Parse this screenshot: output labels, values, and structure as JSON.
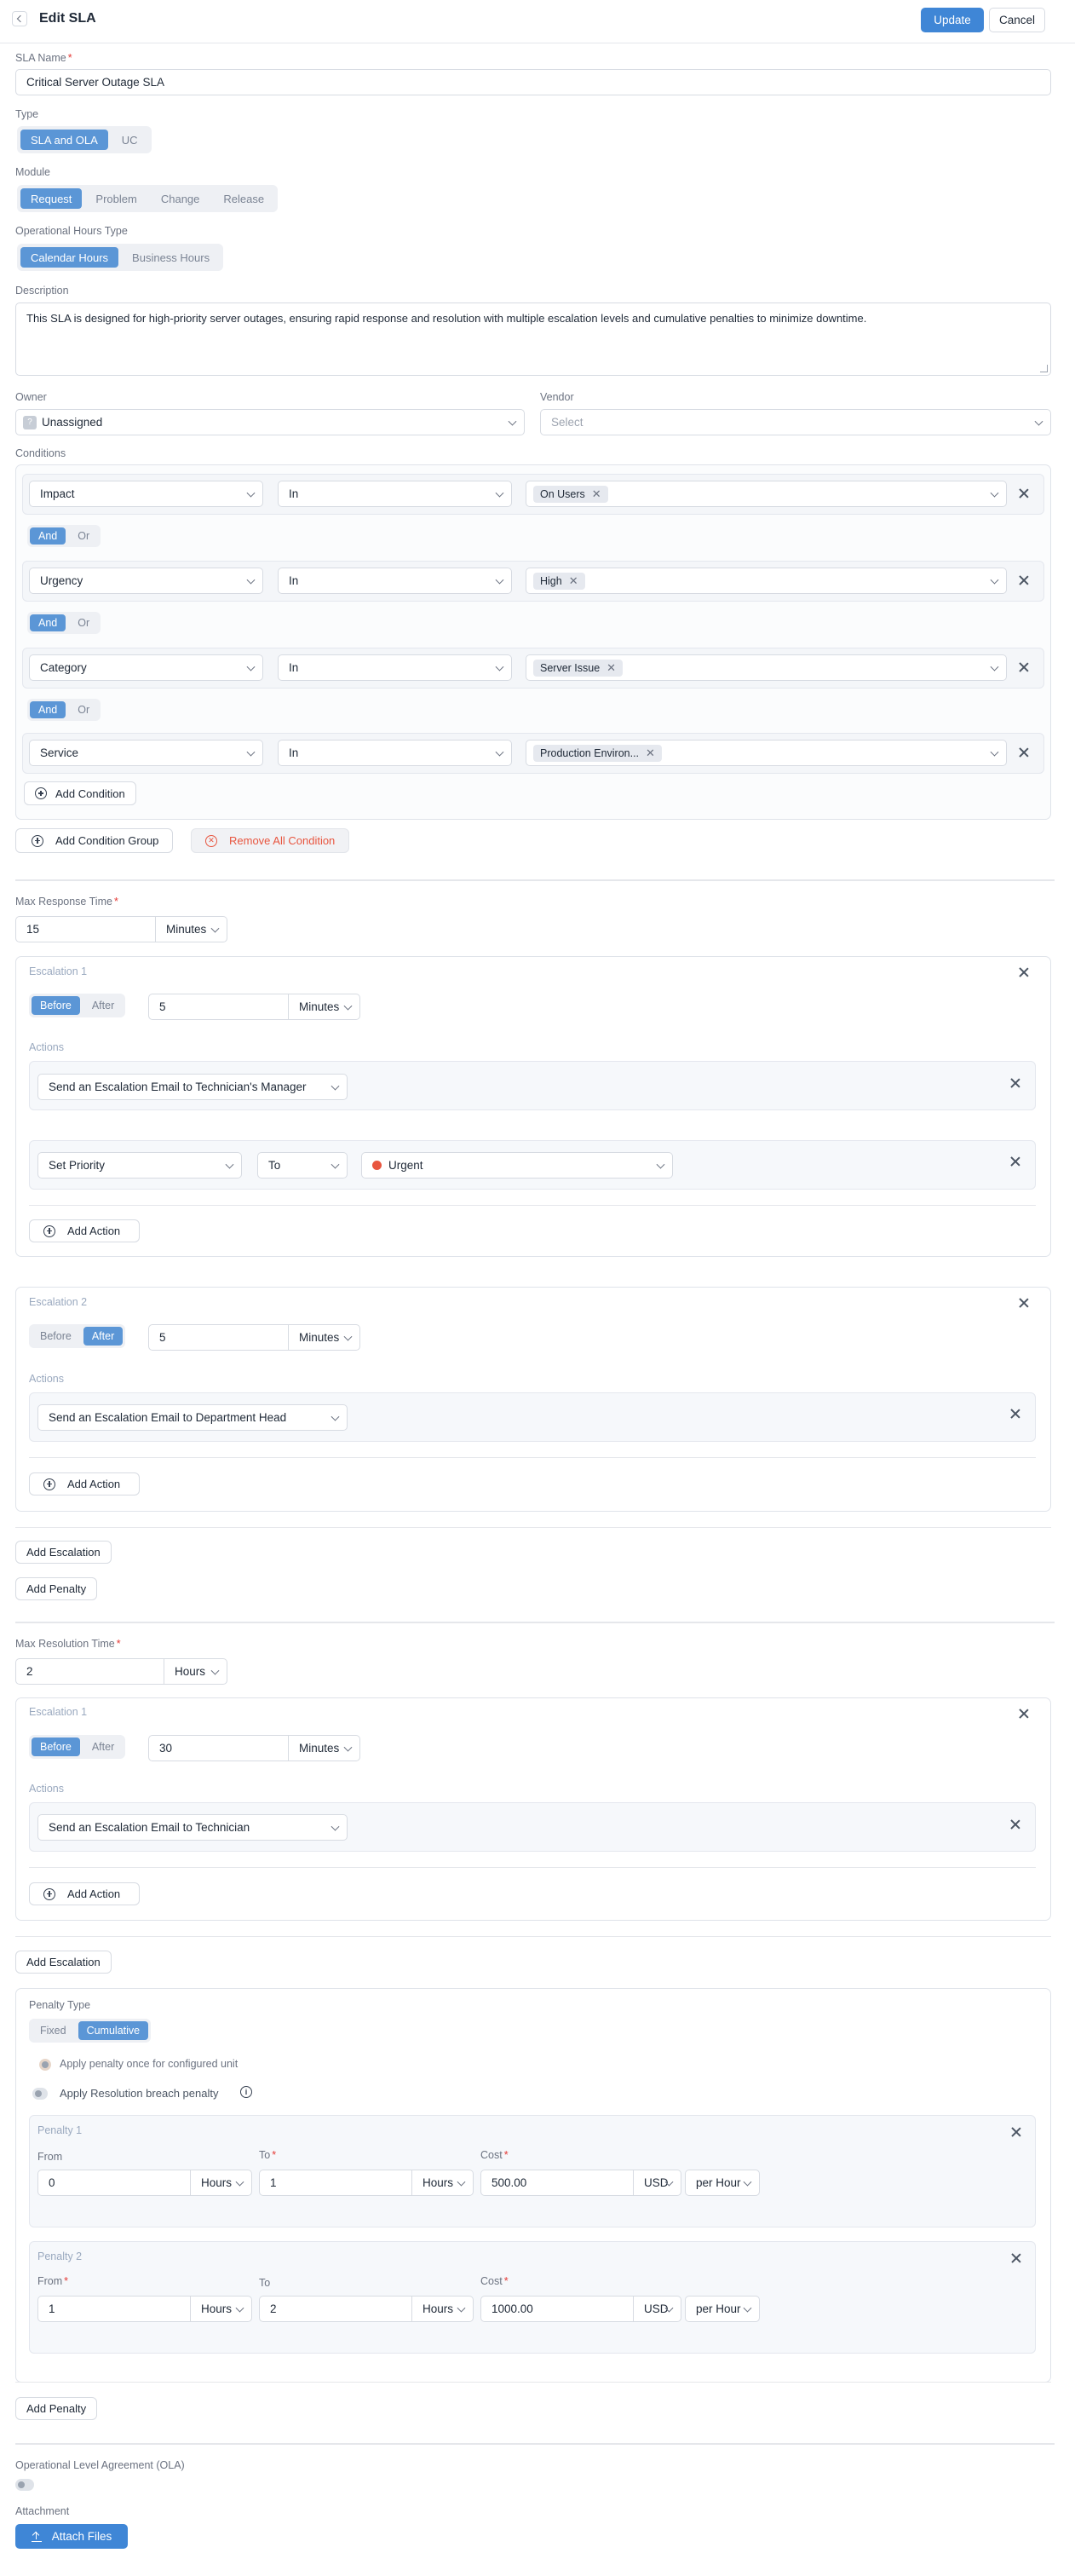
{
  "header": {
    "title": "Edit SLA",
    "update": "Update",
    "cancel": "Cancel"
  },
  "sla_name": {
    "label": "SLA Name",
    "value": "Critical Server Outage SLA"
  },
  "type": {
    "label": "Type",
    "options": [
      "SLA and OLA",
      "UC"
    ],
    "selected": "SLA and OLA"
  },
  "module": {
    "label": "Module",
    "options": [
      "Request",
      "Problem",
      "Change",
      "Release"
    ],
    "selected": "Request"
  },
  "hours_type": {
    "label": "Operational Hours Type",
    "options": [
      "Calendar Hours",
      "Business Hours"
    ],
    "selected": "Calendar Hours"
  },
  "description": {
    "label": "Description",
    "value": "This SLA is designed for high-priority server outages, ensuring rapid response and resolution with multiple escalation levels and cumulative penalties to minimize downtime."
  },
  "owner": {
    "label": "Owner",
    "value": "Unassigned",
    "avatar": "?"
  },
  "vendor": {
    "label": "Vendor",
    "placeholder": "Select"
  },
  "conditions": {
    "label": "Conditions",
    "and": "And",
    "or": "Or",
    "rows": [
      {
        "field": "Impact",
        "op": "In",
        "value": "On Users"
      },
      {
        "field": "Urgency",
        "op": "In",
        "value": "High"
      },
      {
        "field": "Category",
        "op": "In",
        "value": "Server Issue"
      },
      {
        "field": "Service",
        "op": "In",
        "value": "Production Environ..."
      }
    ],
    "add_condition": "Add Condition",
    "add_group": "Add Condition Group",
    "remove_all": "Remove All Condition"
  },
  "response": {
    "label": "Max Response Time",
    "value": "15",
    "unit": "Minutes",
    "esc1": {
      "title": "Escalation 1",
      "before": "Before",
      "after": "After",
      "selected": "Before",
      "value": "5",
      "unit": "Minutes",
      "actions_label": "Actions",
      "action1": "Send an Escalation Email to Technician's Manager",
      "action2": {
        "field": "Set Priority",
        "op": "To",
        "value": "Urgent"
      },
      "add_action": "Add Action"
    },
    "esc2": {
      "title": "Escalation 2",
      "before": "Before",
      "after": "After",
      "selected": "After",
      "value": "5",
      "unit": "Minutes",
      "actions_label": "Actions",
      "action1": "Send an Escalation Email to Department Head",
      "add_action": "Add Action"
    },
    "add_escalation": "Add Escalation",
    "add_penalty": "Add Penalty"
  },
  "resolution": {
    "label": "Max Resolution Time",
    "value": "2",
    "unit": "Hours",
    "esc1": {
      "title": "Escalation 1",
      "before": "Before",
      "after": "After",
      "selected": "Before",
      "value": "30",
      "unit": "Minutes",
      "actions_label": "Actions",
      "action1": "Send an Escalation Email to Technician",
      "add_action": "Add Action"
    },
    "add_escalation": "Add Escalation",
    "penalty": {
      "type_label": "Penalty Type",
      "fixed": "Fixed",
      "cumulative": "Cumulative",
      "selected": "Cumulative",
      "opt1": "Apply penalty once for configured unit",
      "opt2": "Apply Resolution breach penalty",
      "p1": {
        "title": "Penalty 1",
        "from_label": "From",
        "from": "0",
        "from_unit": "Hours",
        "to_label": "To",
        "to": "1",
        "to_unit": "Hours",
        "cost_label": "Cost",
        "cost": "500.00",
        "currency": "USD",
        "per": "per Hour"
      },
      "p2": {
        "title": "Penalty 2",
        "from_label": "From",
        "from": "1",
        "from_unit": "Hours",
        "to_label": "To",
        "to": "2",
        "to_unit": "Hours",
        "cost_label": "Cost",
        "cost": "1000.00",
        "currency": "USD",
        "per": "per Hour"
      }
    },
    "add_penalty": "Add Penalty"
  },
  "ola": {
    "label": "Operational Level Agreement (OLA)"
  },
  "attachment": {
    "label": "Attachment",
    "button": "Attach Files"
  },
  "colors": {
    "accent": "#3f86d6",
    "selected_segment": "#5b96d6",
    "danger": "#e8553f",
    "urgent_dot": "#e8553f"
  }
}
